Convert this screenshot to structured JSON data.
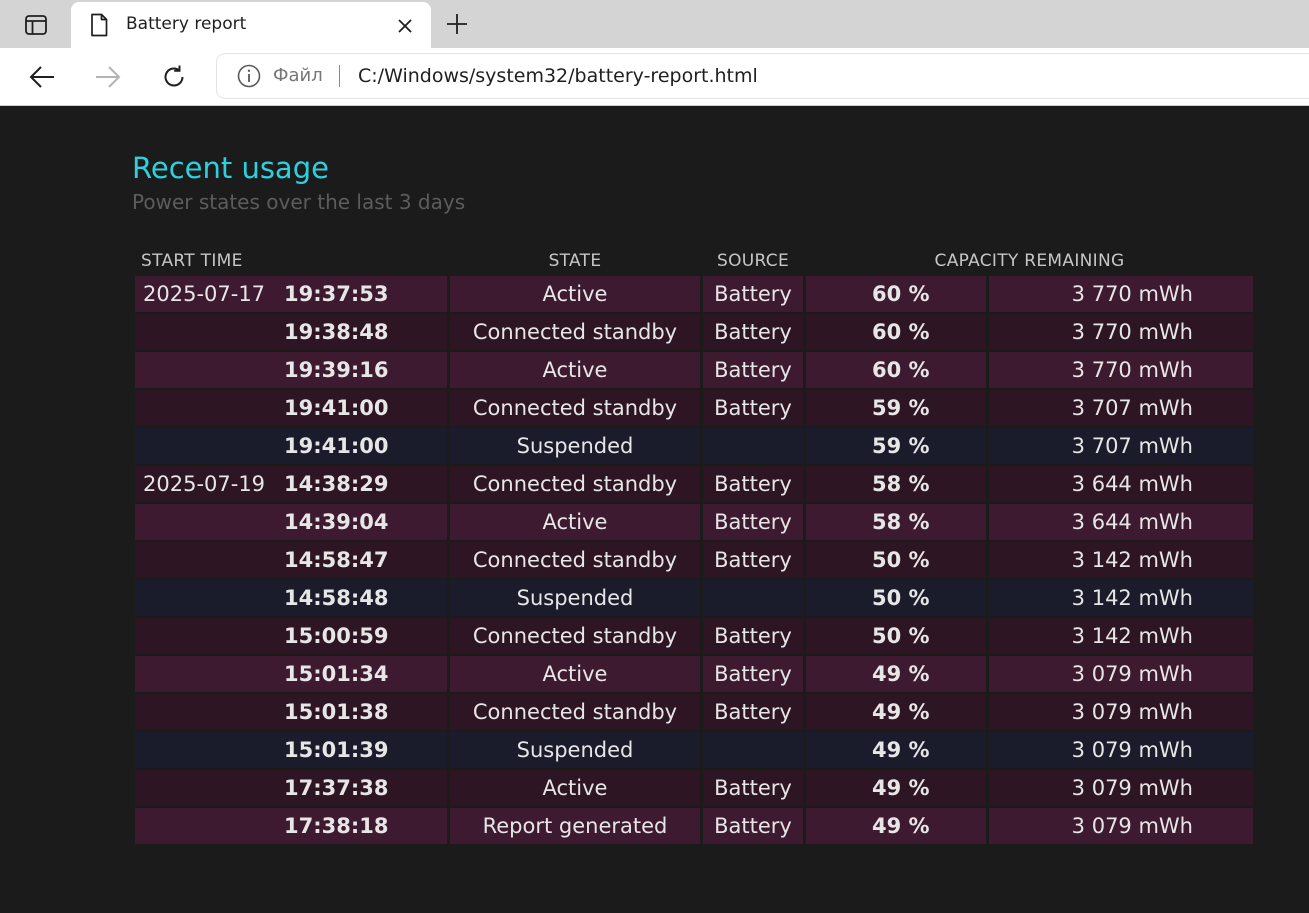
{
  "browser": {
    "tab": {
      "title": "Battery report"
    },
    "address": {
      "scheme_label": "Файл",
      "url": "C:/Windows/system32/battery-report.html"
    },
    "icons": {
      "sidebar": "sidebar-toggle-icon",
      "tab": "document-icon",
      "close": "close-icon",
      "new_tab": "plus-icon",
      "back": "back-arrow-icon",
      "forward": "forward-arrow-icon",
      "refresh": "refresh-icon",
      "site_info": "info-icon"
    }
  },
  "report": {
    "heading": "Recent usage",
    "subheading": "Power states over the last 3 days",
    "columns": {
      "start_time": "START TIME",
      "state": "STATE",
      "source": "SOURCE",
      "capacity": "CAPACITY REMAINING"
    },
    "colors": {
      "heading": "#2fd0de",
      "row_battery_a": "#3d1a30",
      "row_battery_b": "#2e1523",
      "row_suspended": "#1b1c2b"
    },
    "rows": [
      {
        "date": "2025-07-17",
        "time": "19:37:53",
        "state": "Active",
        "source": "Battery",
        "percent": "60 %",
        "capacity": "3 770 mWh",
        "shade": "a"
      },
      {
        "date": "",
        "time": "19:38:48",
        "state": "Connected standby",
        "source": "Battery",
        "percent": "60 %",
        "capacity": "3 770 mWh",
        "shade": "b"
      },
      {
        "date": "",
        "time": "19:39:16",
        "state": "Active",
        "source": "Battery",
        "percent": "60 %",
        "capacity": "3 770 mWh",
        "shade": "a"
      },
      {
        "date": "",
        "time": "19:41:00",
        "state": "Connected standby",
        "source": "Battery",
        "percent": "59 %",
        "capacity": "3 707 mWh",
        "shade": "b"
      },
      {
        "date": "",
        "time": "19:41:00",
        "state": "Suspended",
        "source": "",
        "percent": "59 %",
        "capacity": "3 707 mWh",
        "shade": "s"
      },
      {
        "date": "2025-07-19",
        "time": "14:38:29",
        "state": "Connected standby",
        "source": "Battery",
        "percent": "58 %",
        "capacity": "3 644 mWh",
        "shade": "b"
      },
      {
        "date": "",
        "time": "14:39:04",
        "state": "Active",
        "source": "Battery",
        "percent": "58 %",
        "capacity": "3 644 mWh",
        "shade": "a"
      },
      {
        "date": "",
        "time": "14:58:47",
        "state": "Connected standby",
        "source": "Battery",
        "percent": "50 %",
        "capacity": "3 142 mWh",
        "shade": "b"
      },
      {
        "date": "",
        "time": "14:58:48",
        "state": "Suspended",
        "source": "",
        "percent": "50 %",
        "capacity": "3 142 mWh",
        "shade": "s"
      },
      {
        "date": "",
        "time": "15:00:59",
        "state": "Connected standby",
        "source": "Battery",
        "percent": "50 %",
        "capacity": "3 142 mWh",
        "shade": "b"
      },
      {
        "date": "",
        "time": "15:01:34",
        "state": "Active",
        "source": "Battery",
        "percent": "49 %",
        "capacity": "3 079 mWh",
        "shade": "a"
      },
      {
        "date": "",
        "time": "15:01:38",
        "state": "Connected standby",
        "source": "Battery",
        "percent": "49 %",
        "capacity": "3 079 mWh",
        "shade": "b"
      },
      {
        "date": "",
        "time": "15:01:39",
        "state": "Suspended",
        "source": "",
        "percent": "49 %",
        "capacity": "3 079 mWh",
        "shade": "s"
      },
      {
        "date": "",
        "time": "17:37:38",
        "state": "Active",
        "source": "Battery",
        "percent": "49 %",
        "capacity": "3 079 mWh",
        "shade": "b"
      },
      {
        "date": "",
        "time": "17:38:18",
        "state": "Report generated",
        "source": "Battery",
        "percent": "49 %",
        "capacity": "3 079 mWh",
        "shade": "a"
      }
    ]
  }
}
